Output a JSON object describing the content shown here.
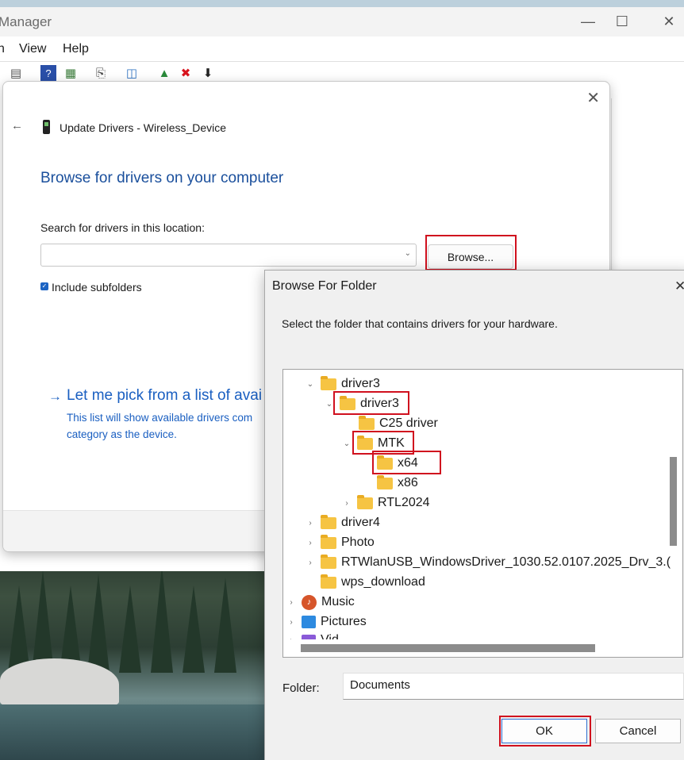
{
  "device_manager": {
    "title": "Manager",
    "menu": [
      "n",
      "View",
      "Help"
    ]
  },
  "update_dialog": {
    "title": "Update Drivers - Wireless_Device",
    "heading": "Browse for drivers on your computer",
    "search_label": "Search for drivers in this location:",
    "location_value": "",
    "browse_label": "Browse...",
    "include_subfolders_label": "Include subfolders",
    "include_subfolders_checked": true,
    "pick_title": "Let me pick from a list of avai",
    "pick_desc_line1": "This list will show available drivers com",
    "pick_desc_line2": "category as the device."
  },
  "browse_folder": {
    "title": "Browse For Folder",
    "instruction": "Select the folder that contains drivers for your hardware.",
    "tree": [
      {
        "label": "driver3",
        "expanded": true
      },
      {
        "label": "driver3",
        "expanded": true,
        "highlighted": true
      },
      {
        "label": "C25 driver"
      },
      {
        "label": "MTK",
        "expanded": true,
        "highlighted": true
      },
      {
        "label": "x64",
        "highlighted": true
      },
      {
        "label": "x86"
      },
      {
        "label": "RTL2024",
        "expandable": true
      },
      {
        "label": "driver4",
        "expandable": true
      },
      {
        "label": "Photo",
        "expandable": true
      },
      {
        "label": "RTWlanUSB_WindowsDriver_1030.52.0107.2025_Drv_3.(",
        "expandable": true
      },
      {
        "label": "wps_download"
      },
      {
        "label": "Music",
        "expandable": true
      },
      {
        "label": "Pictures",
        "expandable": true
      },
      {
        "label": "Vid",
        "expandable": true
      }
    ],
    "folder_label": "Folder:",
    "folder_value": "Documents",
    "ok_label": "OK",
    "cancel_label": "Cancel"
  },
  "colors": {
    "accent_blue": "#1a5fc1",
    "highlight_red": "#d0101e",
    "folder_yellow": "#f6c443"
  }
}
